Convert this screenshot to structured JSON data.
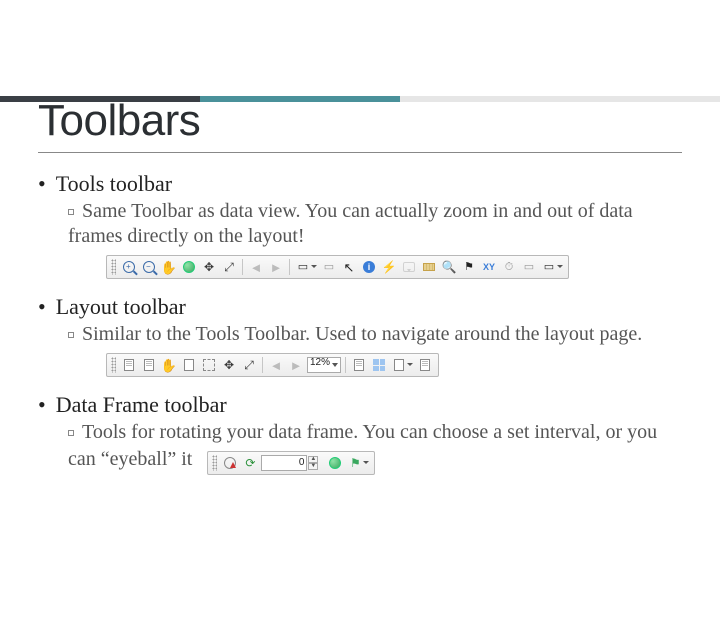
{
  "title": "Toolbars",
  "sections": [
    {
      "heading": "Tools toolbar",
      "sub": "Same Toolbar as data view.  You can actually zoom in and out of data frames directly on the layout!"
    },
    {
      "heading": "Layout toolbar",
      "sub": "Similar to the Tools Toolbar.  Used to navigate around the layout page."
    },
    {
      "heading": "Data Frame toolbar",
      "sub": "Tools for rotating your data frame.  You can choose a set interval, or you can “eyeball” it"
    }
  ],
  "layoutToolbar": {
    "zoomPercent": "12%"
  },
  "dataFrameToolbar": {
    "rotation": "0"
  }
}
